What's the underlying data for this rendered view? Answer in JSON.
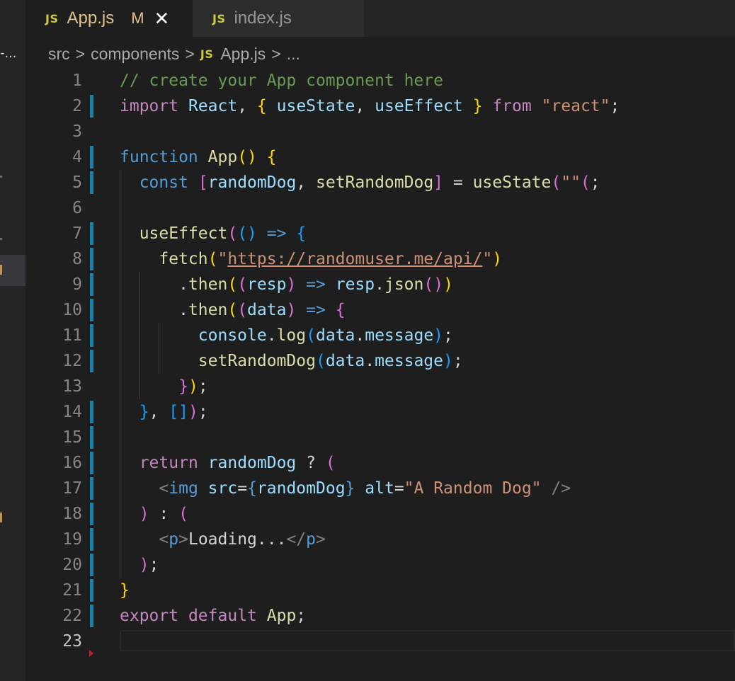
{
  "tabs": [
    {
      "badge": "JS",
      "label": "App.js",
      "status": "M",
      "active": true
    },
    {
      "badge": "JS",
      "label": "index.js",
      "active": false
    }
  ],
  "sidebar": {
    "ellipsis": "-..."
  },
  "breadcrumb": {
    "items": [
      "src",
      "components",
      "App.js",
      "..."
    ],
    "separator": ">",
    "file_badge": "JS"
  },
  "editor": {
    "current_line": 23,
    "lines": [
      {
        "n": "1",
        "tokens": [
          [
            "cm",
            "// create your App component here"
          ]
        ]
      },
      {
        "n": "2",
        "mod": true,
        "tokens": [
          [
            "kw",
            "import"
          ],
          [
            "df",
            " "
          ],
          [
            "vr",
            "React"
          ],
          [
            "df",
            ", "
          ],
          [
            "b1",
            "{"
          ],
          [
            "df",
            " "
          ],
          [
            "vr",
            "useState"
          ],
          [
            "df",
            ", "
          ],
          [
            "vr",
            "useEffect"
          ],
          [
            "df",
            " "
          ],
          [
            "b1",
            "}"
          ],
          [
            "df",
            " "
          ],
          [
            "kw",
            "from"
          ],
          [
            "df",
            " "
          ],
          [
            "st",
            "\"react\""
          ],
          [
            "df",
            ";"
          ]
        ]
      },
      {
        "n": "3",
        "tokens": []
      },
      {
        "n": "4",
        "mod": true,
        "tokens": [
          [
            "kb",
            "function"
          ],
          [
            "df",
            " "
          ],
          [
            "fn",
            "App"
          ],
          [
            "b1",
            "()"
          ],
          [
            "df",
            " "
          ],
          [
            "b1",
            "{"
          ]
        ]
      },
      {
        "n": "5",
        "mod": true,
        "guides": [
          1
        ],
        "tokens": [
          [
            "df",
            "  "
          ],
          [
            "kb",
            "const"
          ],
          [
            "df",
            " "
          ],
          [
            "b2",
            "["
          ],
          [
            "vr",
            "randomDog"
          ],
          [
            "df",
            ", "
          ],
          [
            "fn",
            "setRandomDog"
          ],
          [
            "b2",
            "]"
          ],
          [
            "df",
            " = "
          ],
          [
            "fn",
            "useState"
          ],
          [
            "b2",
            "("
          ],
          [
            "st",
            "\"\""
          ],
          [
            "b2",
            "("
          ],
          [
            "df",
            ";"
          ]
        ]
      },
      {
        "n": "6",
        "guides": [
          1
        ],
        "tokens": []
      },
      {
        "n": "7",
        "mod": true,
        "guides": [
          1
        ],
        "tokens": [
          [
            "df",
            "  "
          ],
          [
            "fn",
            "useEffect"
          ],
          [
            "b2",
            "("
          ],
          [
            "b3",
            "()"
          ],
          [
            "df",
            " "
          ],
          [
            "kb",
            "=>"
          ],
          [
            "df",
            " "
          ],
          [
            "b3",
            "{"
          ]
        ]
      },
      {
        "n": "8",
        "mod": true,
        "guides": [
          1
        ],
        "tokens": [
          [
            "df",
            "    "
          ],
          [
            "fn",
            "fetch"
          ],
          [
            "b1",
            "("
          ],
          [
            "st",
            "\""
          ],
          [
            "st url",
            "https://randomuser.me/api/"
          ],
          [
            "st",
            "\""
          ],
          [
            "b1",
            ")"
          ]
        ]
      },
      {
        "n": "9",
        "mod": true,
        "guides": [
          1,
          2
        ],
        "tokens": [
          [
            "df",
            "      ."
          ],
          [
            "fn",
            "then"
          ],
          [
            "b1",
            "("
          ],
          [
            "b2",
            "("
          ],
          [
            "vr",
            "resp"
          ],
          [
            "b2",
            ")"
          ],
          [
            "df",
            " "
          ],
          [
            "kb",
            "=>"
          ],
          [
            "df",
            " "
          ],
          [
            "vr",
            "resp"
          ],
          [
            "df",
            "."
          ],
          [
            "fn",
            "json"
          ],
          [
            "b2",
            "()"
          ],
          [
            "b1",
            ")"
          ]
        ]
      },
      {
        "n": "10",
        "mod": true,
        "guides": [
          1,
          2
        ],
        "tokens": [
          [
            "df",
            "      ."
          ],
          [
            "fn",
            "then"
          ],
          [
            "b1",
            "("
          ],
          [
            "b2",
            "("
          ],
          [
            "vr",
            "data"
          ],
          [
            "b2",
            ")"
          ],
          [
            "df",
            " "
          ],
          [
            "kb",
            "=>"
          ],
          [
            "df",
            " "
          ],
          [
            "b2",
            "{"
          ]
        ]
      },
      {
        "n": "11",
        "mod": true,
        "guides": [
          1,
          2,
          3
        ],
        "tokens": [
          [
            "df",
            "        "
          ],
          [
            "vr",
            "console"
          ],
          [
            "df",
            "."
          ],
          [
            "fn",
            "log"
          ],
          [
            "b3",
            "("
          ],
          [
            "vr",
            "data"
          ],
          [
            "df",
            "."
          ],
          [
            "vr",
            "message"
          ],
          [
            "b3",
            ")"
          ],
          [
            "df",
            ";"
          ]
        ]
      },
      {
        "n": "12",
        "mod": true,
        "guides": [
          1,
          2,
          3
        ],
        "tokens": [
          [
            "df",
            "        "
          ],
          [
            "fn",
            "setRandomDog"
          ],
          [
            "b3",
            "("
          ],
          [
            "vr",
            "data"
          ],
          [
            "df",
            "."
          ],
          [
            "vr",
            "message"
          ],
          [
            "b3",
            ")"
          ],
          [
            "df",
            ";"
          ]
        ]
      },
      {
        "n": "13",
        "guides": [
          1,
          2
        ],
        "tokens": [
          [
            "df",
            "      "
          ],
          [
            "b2",
            "}"
          ],
          [
            "b1",
            ")"
          ],
          [
            "df",
            ";"
          ]
        ]
      },
      {
        "n": "14",
        "mod": true,
        "guides": [
          1
        ],
        "tokens": [
          [
            "df",
            "  "
          ],
          [
            "b3",
            "}"
          ],
          [
            "df",
            ", "
          ],
          [
            "b3",
            "[]"
          ],
          [
            "b2",
            ")"
          ],
          [
            "df",
            ";"
          ]
        ]
      },
      {
        "n": "15",
        "mod": true,
        "guides": [
          1
        ],
        "tokens": []
      },
      {
        "n": "16",
        "mod": true,
        "guides": [
          1
        ],
        "tokens": [
          [
            "df",
            "  "
          ],
          [
            "kw",
            "return"
          ],
          [
            "df",
            " "
          ],
          [
            "vr",
            "randomDog"
          ],
          [
            "df",
            " ? "
          ],
          [
            "b2",
            "("
          ]
        ]
      },
      {
        "n": "17",
        "mod": true,
        "guides": [
          1
        ],
        "tokens": [
          [
            "df",
            "    "
          ],
          [
            "tg",
            "<"
          ],
          [
            "tn",
            "img"
          ],
          [
            "df",
            " "
          ],
          [
            "vr",
            "src"
          ],
          [
            "df",
            "="
          ],
          [
            "kb",
            "{"
          ],
          [
            "vr",
            "randomDog"
          ],
          [
            "kb",
            "}"
          ],
          [
            "df",
            " "
          ],
          [
            "vr",
            "alt"
          ],
          [
            "df",
            "="
          ],
          [
            "st",
            "\"A Random Dog\""
          ],
          [
            "df",
            " "
          ],
          [
            "tg",
            "/>"
          ]
        ]
      },
      {
        "n": "18",
        "mod": true,
        "guides": [
          1
        ],
        "tokens": [
          [
            "df",
            "  "
          ],
          [
            "b2",
            ")"
          ],
          [
            "df",
            " : "
          ],
          [
            "b2",
            "("
          ]
        ]
      },
      {
        "n": "19",
        "mod": true,
        "guides": [
          1
        ],
        "tokens": [
          [
            "df",
            "    "
          ],
          [
            "tg",
            "<"
          ],
          [
            "tn",
            "p"
          ],
          [
            "tg",
            ">"
          ],
          [
            "df",
            "Loading..."
          ],
          [
            "tg",
            "</"
          ],
          [
            "tn",
            "p"
          ],
          [
            "tg",
            ">"
          ]
        ]
      },
      {
        "n": "20",
        "mod": true,
        "guides": [
          1
        ],
        "tokens": [
          [
            "df",
            "  "
          ],
          [
            "b2",
            ")"
          ],
          [
            "df",
            ";"
          ]
        ]
      },
      {
        "n": "21",
        "mod": true,
        "tokens": [
          [
            "b1",
            "}"
          ]
        ]
      },
      {
        "n": "22",
        "mod": true,
        "tokens": [
          [
            "kw",
            "export"
          ],
          [
            "df",
            " "
          ],
          [
            "kw",
            "default"
          ],
          [
            "df",
            " "
          ],
          [
            "fn",
            "App"
          ],
          [
            "df",
            ";"
          ]
        ]
      },
      {
        "n": "23",
        "tokens": []
      }
    ]
  }
}
